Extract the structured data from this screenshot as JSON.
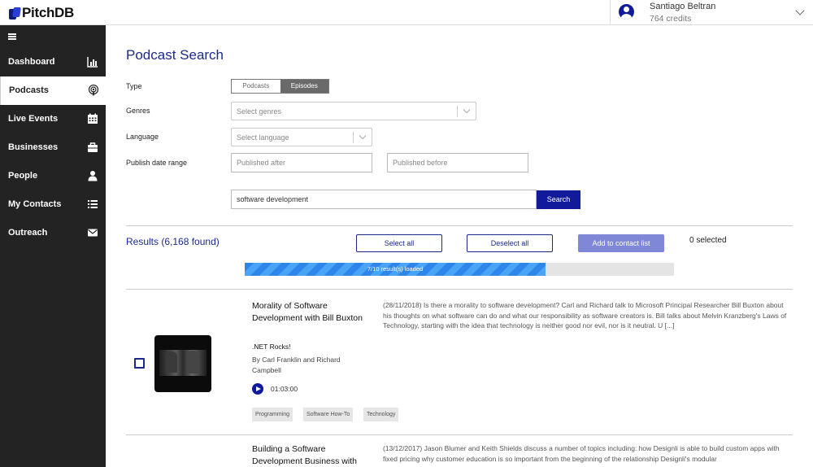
{
  "app": {
    "name": "PitchDB"
  },
  "user": {
    "name": "Santiago Beltran",
    "credits": "764 credits"
  },
  "sidebar": {
    "items": [
      {
        "label": "Dashboard",
        "icon": "bar-chart-icon",
        "active": false
      },
      {
        "label": "Podcasts",
        "icon": "podcast-icon",
        "active": true
      },
      {
        "label": "Live Events",
        "icon": "calendar-icon",
        "active": false
      },
      {
        "label": "Businesses",
        "icon": "briefcase-icon",
        "active": false
      },
      {
        "label": "People",
        "icon": "person-icon",
        "active": false
      },
      {
        "label": "My Contacts",
        "icon": "list-icon",
        "active": false
      },
      {
        "label": "Outreach",
        "icon": "envelope-icon",
        "active": false
      }
    ]
  },
  "page": {
    "title": "Podcast Search"
  },
  "form": {
    "type_label": "Type",
    "type_options": [
      "Podcasts",
      "Episodes"
    ],
    "type_selected": "Episodes",
    "genres_label": "Genres",
    "genres_placeholder": "Select genres",
    "language_label": "Language",
    "language_placeholder": "Select language",
    "date_label": "Publish date range",
    "after_placeholder": "Published after",
    "before_placeholder": "Published before",
    "search_value": "software development",
    "search_button": "Search"
  },
  "results": {
    "title": "Results (6,168 found)",
    "select_all": "Select all",
    "deselect_all": "Deselect all",
    "add_to_contact": "Add to contact list",
    "selected": "0 selected",
    "progress_text": "7/10 result(s) loaded",
    "progress_fraction": 0.7,
    "colors": {
      "accent": "#101a9a",
      "progress": "#2e86ea",
      "disabled": "#7f88d6"
    },
    "items": [
      {
        "title": "Morality of Software Development with Bill Buxton",
        "podcast": ".NET Rocks!",
        "author": "By Carl Franklin and Richard Campbell",
        "duration": "01:03:00",
        "tags": [
          "Programming",
          "Software How-To",
          "Technology"
        ],
        "description": "(28/11/2018) Is there a morality to software development? Carl and Richard talk to Microsoft Principal Researcher Bill Buxton about his thoughts on what software can do and what our responsibility as software creators is. Bill talks about Melvin Kranzberg's Laws of Technology, starting with the idea that technology is neither good nor evil, nor is it neutral. U [...]"
      },
      {
        "title": "Building a Software Development Business with",
        "description": "(13/12/2017) Jason Blumer and Keith Shields discuss a number of topics including: how Designli is able to build custom apps with fixed pricing why customer education is so important from the beginning of the relationship Designli's modular"
      }
    ]
  }
}
